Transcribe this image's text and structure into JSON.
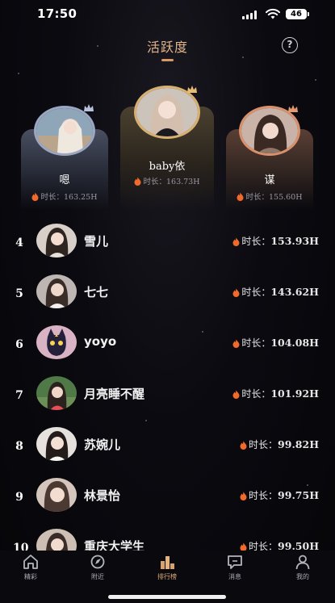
{
  "status_bar": {
    "time": "17:50",
    "battery": "46"
  },
  "header": {
    "title": "活跃度",
    "help_icon": "question-circle-icon"
  },
  "podium": [
    {
      "rank": 2,
      "name": "嗯",
      "duration_label": "时长：",
      "duration": "163.25H",
      "accent": "#9aa6c2"
    },
    {
      "rank": 1,
      "name": "baby依",
      "duration_label": "时长：",
      "duration": "163.73H",
      "accent": "#d7b06f"
    },
    {
      "rank": 3,
      "name": "谋",
      "duration_label": "时长：",
      "duration": "155.60H",
      "accent": "#d9916b"
    }
  ],
  "rank_list": [
    {
      "rank": "4",
      "name": "雪儿",
      "duration_label": "时长：",
      "duration": "153.93H"
    },
    {
      "rank": "5",
      "name": "七七",
      "duration_label": "时长：",
      "duration": "143.62H"
    },
    {
      "rank": "6",
      "name": "yoyo",
      "duration_label": "时长：",
      "duration": "104.08H"
    },
    {
      "rank": "7",
      "name": "月亮睡不醒",
      "duration_label": "时长：",
      "duration": "101.92H"
    },
    {
      "rank": "8",
      "name": "苏婉儿",
      "duration_label": "时长：",
      "duration": "99.82H"
    },
    {
      "rank": "9",
      "name": "林景怡",
      "duration_label": "时长：",
      "duration": "99.75H"
    },
    {
      "rank": "10",
      "name": "重庆大学生",
      "duration_label": "时长：",
      "duration": "99.50H"
    }
  ],
  "bottom_nav": [
    {
      "label": "精彩",
      "icon": "home-icon",
      "active": false
    },
    {
      "label": "附近",
      "icon": "nearby-icon",
      "active": false
    },
    {
      "label": "排行榜",
      "icon": "ranking-icon",
      "active": true
    },
    {
      "label": "消息",
      "icon": "message-icon",
      "active": false
    },
    {
      "label": "我的",
      "icon": "profile-icon",
      "active": false
    }
  ],
  "colors": {
    "accent": "#e0b48a",
    "flame": "#f06a2c",
    "background": "#07070c"
  }
}
